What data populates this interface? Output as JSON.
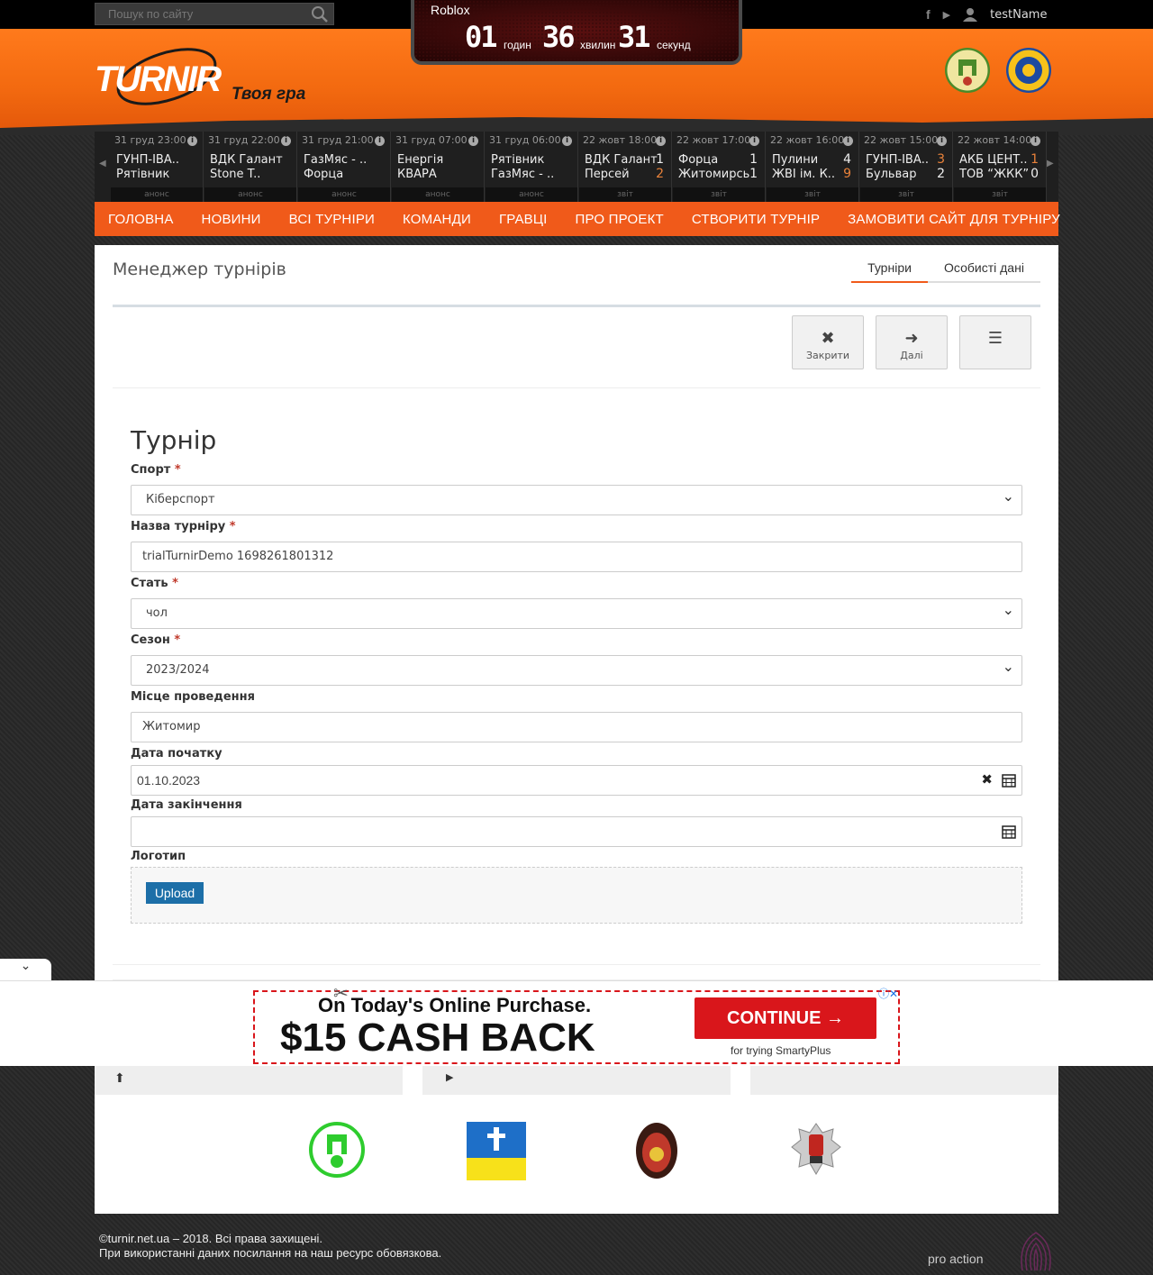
{
  "search": {
    "placeholder": "Пошук по сайту"
  },
  "user": {
    "name": "testName"
  },
  "logo": {
    "wordmark": "TURNIR",
    "tagline": "Твоя гра"
  },
  "countdown": {
    "title": "Roblox",
    "hours": "01",
    "hours_label": "годин",
    "minutes": "36",
    "minutes_label": "хвилин",
    "seconds": "31",
    "seconds_label": "секунд"
  },
  "matches": [
    {
      "date": "31 груд 23:00",
      "team1": "ГУНП-ІВА..",
      "team2": "Рятівник",
      "score1": "",
      "score2": "",
      "footer": "анонс"
    },
    {
      "date": "31 груд 22:00",
      "team1": "ВДК Галант",
      "team2": "Stone T..",
      "score1": "",
      "score2": "",
      "footer": "анонс"
    },
    {
      "date": "31 груд 21:00",
      "team1": "ГазМяс - ..",
      "team2": "Форца",
      "score1": "",
      "score2": "",
      "footer": "анонс"
    },
    {
      "date": "31 груд 07:00",
      "team1": "Енергія",
      "team2": "КВАРА",
      "score1": "",
      "score2": "",
      "footer": "анонс"
    },
    {
      "date": "31 груд 06:00",
      "team1": "Рятівник",
      "team2": "ГазМяс - ..",
      "score1": "",
      "score2": "",
      "footer": "анонс"
    },
    {
      "date": "22 жовт 18:00",
      "team1": "ВДК Галант",
      "team2": "Персей",
      "score1": "1",
      "score2": "2",
      "footer": "звіт"
    },
    {
      "date": "22 жовт 17:00",
      "team1": "Форца",
      "team2": "Житомирсь",
      "score1": "1",
      "score2": "1",
      "footer": "звіт"
    },
    {
      "date": "22 жовт 16:00",
      "team1": "Пулини",
      "team2": "ЖВІ ім. К..",
      "score1": "4",
      "score2": "9",
      "footer": "звіт"
    },
    {
      "date": "22 жовт 15:00",
      "team1": "ГУНП-ІВА..",
      "team2": "Бульвар",
      "score1": "3",
      "score2": "2",
      "footer": "звіт"
    },
    {
      "date": "22 жовт 14:00",
      "team1": "АКБ ЦЕНТ..",
      "team2": "ТОВ “ЖКК”",
      "score1": "1",
      "score2": "0",
      "footer": "звіт"
    }
  ],
  "nav": [
    "ГОЛОВНА",
    "НОВИНИ",
    "ВСІ ТУРНІРИ",
    "КОМАНДИ",
    "ГРАВЦІ",
    "ПРО ПРОЕКТ",
    "СТВОРИТИ ТУРНІР",
    "ЗАМОВИТИ САЙТ ДЛЯ ТУРНІРУ"
  ],
  "page": {
    "title": "Менеджер турнірів",
    "tabs": [
      "Турніри",
      "Особисті дані"
    ],
    "toolbar": {
      "close_label": "Закрити",
      "next_label": "Далі"
    }
  },
  "form": {
    "title": "Турнір",
    "sport": {
      "label": "Спорт",
      "value": "Кіберспорт"
    },
    "name": {
      "label": "Назва турніру",
      "value": "trialTurnirDemo 1698261801312"
    },
    "gender": {
      "label": "Стать",
      "value": "чол"
    },
    "season": {
      "label": "Сезон",
      "value": "2023/2024"
    },
    "venue": {
      "label": "Місце проведення",
      "value": "Житомир"
    },
    "start_date": {
      "label": "Дата початку",
      "value": "01.10.2023"
    },
    "end_date": {
      "label": "Дата закінчення",
      "value": ""
    },
    "logo": {
      "label": "Логотип",
      "upload_label": "Upload"
    }
  },
  "ad": {
    "line1": "On Today's Online Purchase.",
    "line2": "$15 CASH BACK",
    "button": "CONTINUE →",
    "sub": "for trying SmartyPlus"
  },
  "footer": {
    "copyright": "©turnir.net.ua – 2018. Всі права захищені.",
    "notice": "При використанні даних посилання на наш ресурс обовязкова.",
    "credit": "pro action"
  },
  "colors": {
    "accent": "#f05a1a",
    "nav": "#f05a1a",
    "upload": "#1d6fa8",
    "ad_red": "#d9161b"
  }
}
